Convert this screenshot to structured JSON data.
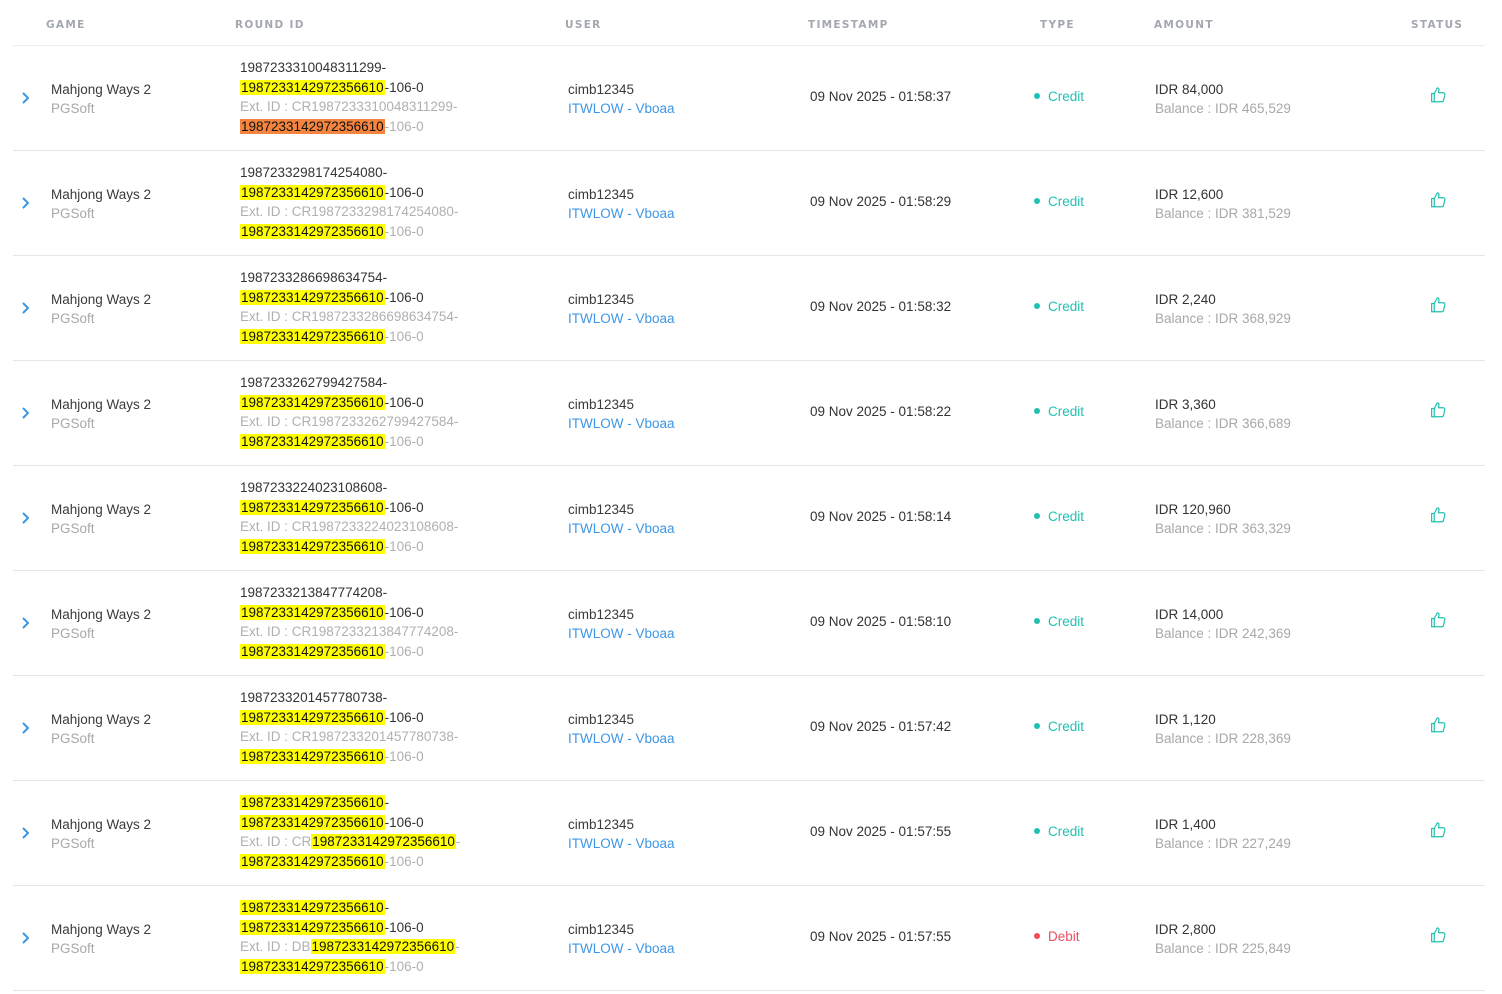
{
  "headers": {
    "game": "GAME",
    "round_id": "ROUND ID",
    "user": "USER",
    "timestamp": "TIMESTAMP",
    "type": "TYPE",
    "amount": "AMOUNT",
    "status": "STATUS"
  },
  "colors": {
    "credit": "#21c1b0",
    "debit": "#ee4d5f",
    "link": "#3d96e6",
    "highlight": "#ffff00",
    "highlight_current": "#f4843e"
  },
  "icons": {
    "expand": "chevron-right-icon",
    "status": "thumbs-up-icon"
  },
  "rows": [
    {
      "game": "Mahjong Ways 2",
      "provider": "PGSoft",
      "round": {
        "l1_pre": "1987233310048311299-",
        "l2_hl": "1987233142972356610",
        "l2_post": "-106-0",
        "l3_pre": "Ext. ID : CR1987233310048311299-",
        "l3_hl": "",
        "l3_post": "",
        "l4_hl": "1987233142972356610",
        "l4_post": "-106-0"
      },
      "user": "cimb12345",
      "user_link": "ITWLOW - Vboaa",
      "timestamp": "09 Nov 2025 - 01:58:37",
      "type": "Credit",
      "amount": "IDR 84,000",
      "balance": "Balance : IDR 465,529"
    },
    {
      "game": "Mahjong Ways 2",
      "provider": "PGSoft",
      "round": {
        "l1_pre": "1987233298174254080-",
        "l2_hl": "1987233142972356610",
        "l2_post": "-106-0",
        "l3_pre": "Ext. ID : CR1987233298174254080-",
        "l3_hl": "",
        "l3_post": "",
        "l4_hl": "1987233142972356610",
        "l4_post": "-106-0"
      },
      "user": "cimb12345",
      "user_link": "ITWLOW - Vboaa",
      "timestamp": "09 Nov 2025 - 01:58:29",
      "type": "Credit",
      "amount": "IDR 12,600",
      "balance": "Balance : IDR 381,529"
    },
    {
      "game": "Mahjong Ways 2",
      "provider": "PGSoft",
      "round": {
        "l1_pre": "1987233286698634754-",
        "l2_hl": "1987233142972356610",
        "l2_post": "-106-0",
        "l3_pre": "Ext. ID : CR1987233286698634754-",
        "l3_hl": "",
        "l3_post": "",
        "l4_hl": "1987233142972356610",
        "l4_post": "-106-0"
      },
      "user": "cimb12345",
      "user_link": "ITWLOW - Vboaa",
      "timestamp": "09 Nov 2025 - 01:58:32",
      "type": "Credit",
      "amount": "IDR 2,240",
      "balance": "Balance : IDR 368,929"
    },
    {
      "game": "Mahjong Ways 2",
      "provider": "PGSoft",
      "round": {
        "l1_pre": "1987233262799427584-",
        "l2_hl": "1987233142972356610",
        "l2_post": "-106-0",
        "l3_pre": "Ext. ID : CR1987233262799427584-",
        "l3_hl": "",
        "l3_post": "",
        "l4_hl": "1987233142972356610",
        "l4_post": "-106-0"
      },
      "user": "cimb12345",
      "user_link": "ITWLOW - Vboaa",
      "timestamp": "09 Nov 2025 - 01:58:22",
      "type": "Credit",
      "amount": "IDR 3,360",
      "balance": "Balance : IDR 366,689"
    },
    {
      "game": "Mahjong Ways 2",
      "provider": "PGSoft",
      "round": {
        "l1_pre": "1987233224023108608-",
        "l2_hl": "1987233142972356610",
        "l2_post": "-106-0",
        "l3_pre": "Ext. ID : CR1987233224023108608-",
        "l3_hl": "",
        "l3_post": "",
        "l4_hl": "1987233142972356610",
        "l4_post": "-106-0"
      },
      "user": "cimb12345",
      "user_link": "ITWLOW - Vboaa",
      "timestamp": "09 Nov 2025 - 01:58:14",
      "type": "Credit",
      "amount": "IDR 120,960",
      "balance": "Balance : IDR 363,329"
    },
    {
      "game": "Mahjong Ways 2",
      "provider": "PGSoft",
      "round": {
        "l1_pre": "1987233213847774208-",
        "l2_hl": "1987233142972356610",
        "l2_post": "-106-0",
        "l3_pre": "Ext. ID : CR1987233213847774208-",
        "l3_hl": "",
        "l3_post": "",
        "l4_hl": "1987233142972356610",
        "l4_post": "-106-0"
      },
      "user": "cimb12345",
      "user_link": "ITWLOW - Vboaa",
      "timestamp": "09 Nov 2025 - 01:58:10",
      "type": "Credit",
      "amount": "IDR 14,000",
      "balance": "Balance : IDR 242,369"
    },
    {
      "game": "Mahjong Ways 2",
      "provider": "PGSoft",
      "round": {
        "l1_pre": "1987233201457780738-",
        "l2_hl": "1987233142972356610",
        "l2_post": "-106-0",
        "l3_pre": "Ext. ID : CR1987233201457780738-",
        "l3_hl": "",
        "l3_post": "",
        "l4_hl": "1987233142972356610",
        "l4_post": "-106-0"
      },
      "user": "cimb12345",
      "user_link": "ITWLOW - Vboaa",
      "timestamp": "09 Nov 2025 - 01:57:42",
      "type": "Credit",
      "amount": "IDR 1,120",
      "balance": "Balance : IDR 228,369"
    },
    {
      "game": "Mahjong Ways 2",
      "provider": "PGSoft",
      "round": {
        "l1_hl": "1987233142972356610",
        "l1_post": "-",
        "l2_hl": "1987233142972356610",
        "l2_post": "-106-0",
        "l3_pre": "Ext. ID : CR",
        "l3_hl": "1987233142972356610",
        "l3_post": "-",
        "l4_hl": "1987233142972356610",
        "l4_post": "-106-0"
      },
      "user": "cimb12345",
      "user_link": "ITWLOW - Vboaa",
      "timestamp": "09 Nov 2025 - 01:57:55",
      "type": "Credit",
      "amount": "IDR 1,400",
      "balance": "Balance : IDR 227,249"
    },
    {
      "game": "Mahjong Ways 2",
      "provider": "PGSoft",
      "round": {
        "l1_hl": "1987233142972356610",
        "l1_post": "-",
        "l2_hl": "1987233142972356610",
        "l2_post": "-106-0",
        "l3_pre": "Ext. ID : DB",
        "l3_hl": "1987233142972356610",
        "l3_post": "-",
        "l4_hl": "1987233142972356610",
        "l4_post": "-106-0"
      },
      "user": "cimb12345",
      "user_link": "ITWLOW - Vboaa",
      "timestamp": "09 Nov 2025 - 01:57:55",
      "type": "Debit",
      "amount": "IDR 2,800",
      "balance": "Balance : IDR 225,849"
    }
  ]
}
